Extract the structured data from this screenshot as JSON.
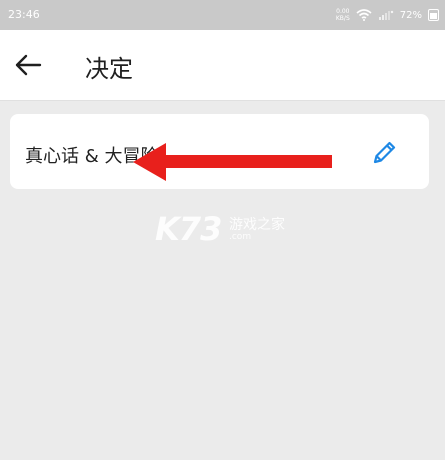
{
  "status_bar": {
    "time": "23:46",
    "net_speed_value": "0.00",
    "net_speed_unit": "KB/S",
    "battery": "72%"
  },
  "app_bar": {
    "back_icon": "arrow-left-icon",
    "title": "决定"
  },
  "card": {
    "label": "真心话 & 大冒险",
    "edit_icon": "pencil-icon"
  },
  "annotation": {
    "arrow_color": "#e8201c",
    "direction": "left"
  },
  "watermark": {
    "brand": "K73",
    "name": "游戏之家",
    "domain": ".com"
  },
  "colors": {
    "accent": "#1e88e5",
    "background": "#ebebeb",
    "surface": "#ffffff",
    "status_bar": "#c9c9c9"
  }
}
